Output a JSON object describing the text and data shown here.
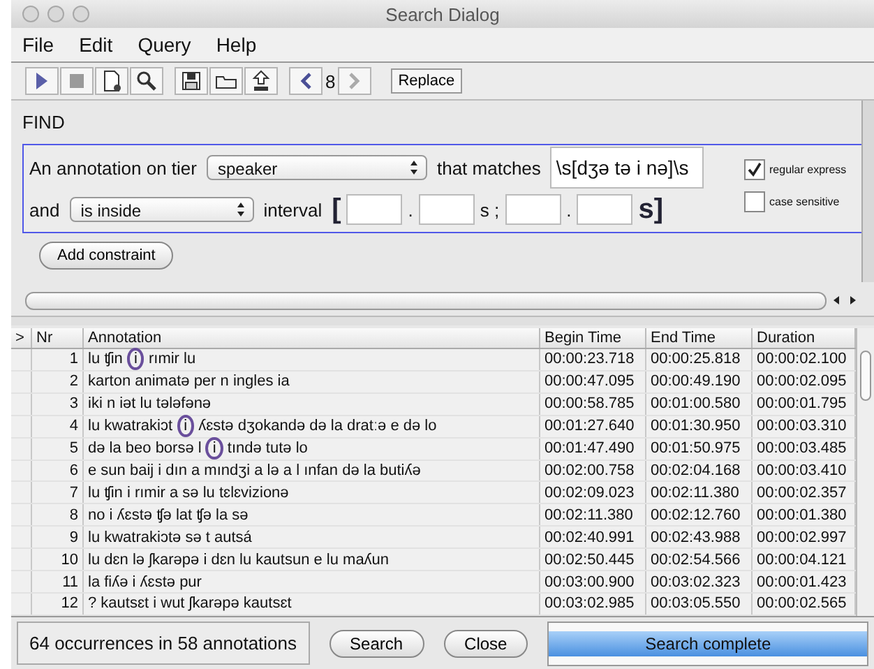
{
  "window": {
    "title": "Search Dialog"
  },
  "menu": [
    "File",
    "Edit",
    "Query",
    "Help"
  ],
  "toolbar": {
    "page": "8",
    "replace": "Replace"
  },
  "find": {
    "heading": "FIND",
    "row1": {
      "label": "An annotation on tier",
      "tier": "speaker",
      "matches_label": "that matches",
      "pattern": "\\s[dʒə tə i nə]\\s"
    },
    "row2": {
      "label": "and",
      "relation": "is inside",
      "interval_label": "interval",
      "open": "[",
      "dot1": ".",
      "sep": "s ;",
      "dot2": ".",
      "close": "s]"
    },
    "options": [
      {
        "label": "regular express",
        "checked": true
      },
      {
        "label": "case sensitive",
        "checked": false
      }
    ],
    "add_button": "Add constraint"
  },
  "table": {
    "columns": [
      ">",
      "Nr",
      "Annotation",
      "Begin Time",
      "End Time",
      "Duration"
    ],
    "rows": [
      {
        "nr": "1",
        "annotation": "lu ʧin *i* rımir lu",
        "begin": "00:00:23.718",
        "end": "00:00:25.818",
        "duration": "00:00:02.100"
      },
      {
        "nr": "2",
        "annotation": "karton animatə per n ingles ia",
        "begin": "00:00:47.095",
        "end": "00:00:49.190",
        "duration": "00:00:02.095"
      },
      {
        "nr": "3",
        "annotation": "iki n iət lu tələfənə",
        "begin": "00:00:58.785",
        "end": "00:01:00.580",
        "duration": "00:00:01.795"
      },
      {
        "nr": "4",
        "annotation": "lu kwatrakiɔt *i* ʎɛstə dʒokandə də la dratːə e də lo",
        "begin": "00:01:27.640",
        "end": "00:01:30.950",
        "duration": "00:00:03.310"
      },
      {
        "nr": "5",
        "annotation": "də la beo borsə l *i* tındə tutə lo",
        "begin": "00:01:47.490",
        "end": "00:01:50.975",
        "duration": "00:00:03.485"
      },
      {
        "nr": "6",
        "annotation": "e sun baij i dın a mındʒi a lə a l ınfan də la butiʎə",
        "begin": "00:02:00.758",
        "end": "00:02:04.168",
        "duration": "00:00:03.410"
      },
      {
        "nr": "7",
        "annotation": "lu ʧin i rımir a sə lu tɛlɛvizionə",
        "begin": "00:02:09.023",
        "end": "00:02:11.380",
        "duration": "00:00:02.357"
      },
      {
        "nr": "8",
        "annotation": "no i ʎɛstə ʧə lat ʧə la sə",
        "begin": "00:02:11.380",
        "end": "00:02:12.760",
        "duration": "00:00:01.380"
      },
      {
        "nr": "9",
        "annotation": "lu kwatrakiɔtə sə t autsá",
        "begin": "00:02:40.991",
        "end": "00:02:43.988",
        "duration": "00:00:02.997"
      },
      {
        "nr": "10",
        "annotation": "lu dɛn lə ʃkarəpə i dɛn lu kautsun e lu maʎun",
        "begin": "00:02:50.445",
        "end": "00:02:54.566",
        "duration": "00:00:04.121"
      },
      {
        "nr": "11",
        "annotation": "la fiʎə i ʎɛstə pur",
        "begin": "00:03:00.900",
        "end": "00:03:02.323",
        "duration": "00:00:01.423"
      },
      {
        "nr": "12",
        "annotation": "? kautsɛt i wut ʃkarəpə kautsɛt",
        "begin": "00:03:02.985",
        "end": "00:03:05.550",
        "duration": "00:00:02.565"
      }
    ]
  },
  "status": {
    "summary": "64 occurrences in 58 annotations",
    "search_button": "Search",
    "close_button": "Close",
    "progress": {
      "label": "Search complete",
      "level": 1
    }
  }
}
